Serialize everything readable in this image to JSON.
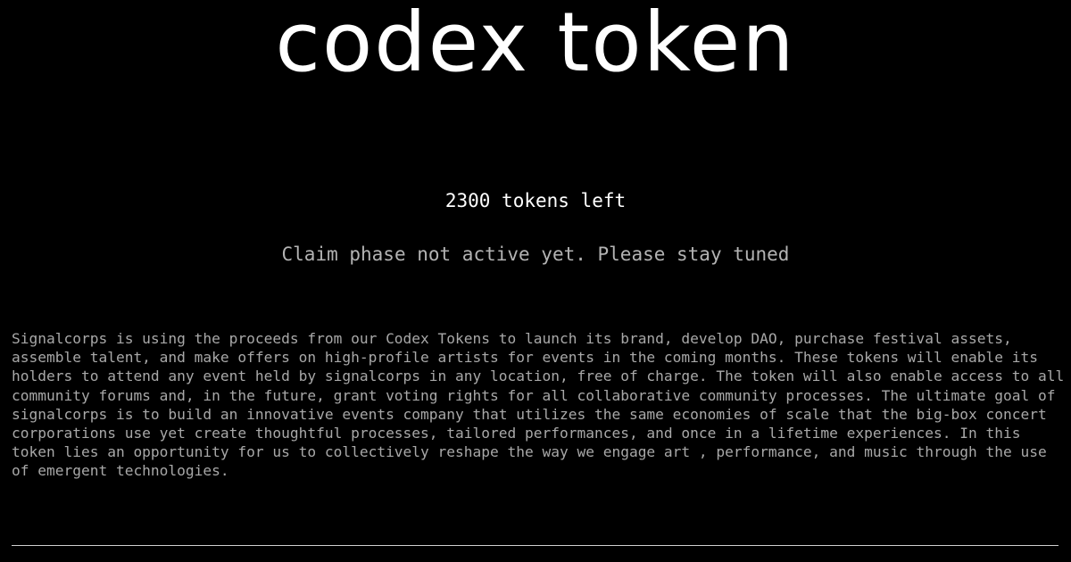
{
  "header": {
    "title": "codex token"
  },
  "status": {
    "tokens_left": "2300 tokens left",
    "claim_message": "Claim phase not active yet. Please stay tuned"
  },
  "content": {
    "description": "Signalcorps is using the proceeds from our Codex Tokens to launch its brand, develop DAO, purchase festival assets, assemble talent, and make offers on high-profile artists for events in the coming months. These tokens will enable its holders to attend any event held by signalcorps in any location, free of charge. The token will also enable access to all community forums and, in the future, grant voting rights for all collaborative community processes. The ultimate goal of signalcorps is to build an innovative events company that utilizes the same economies of scale that the big-box concert corporations use yet create thoughtful processes, tailored performances, and once in a lifetime experiences. In this token lies an opportunity for us to collectively reshape the way we engage art , performance, and music through the use of emergent technologies."
  },
  "colors": {
    "background": "#000000",
    "title": "#ffffff",
    "body_text": "#a8a8a8"
  }
}
